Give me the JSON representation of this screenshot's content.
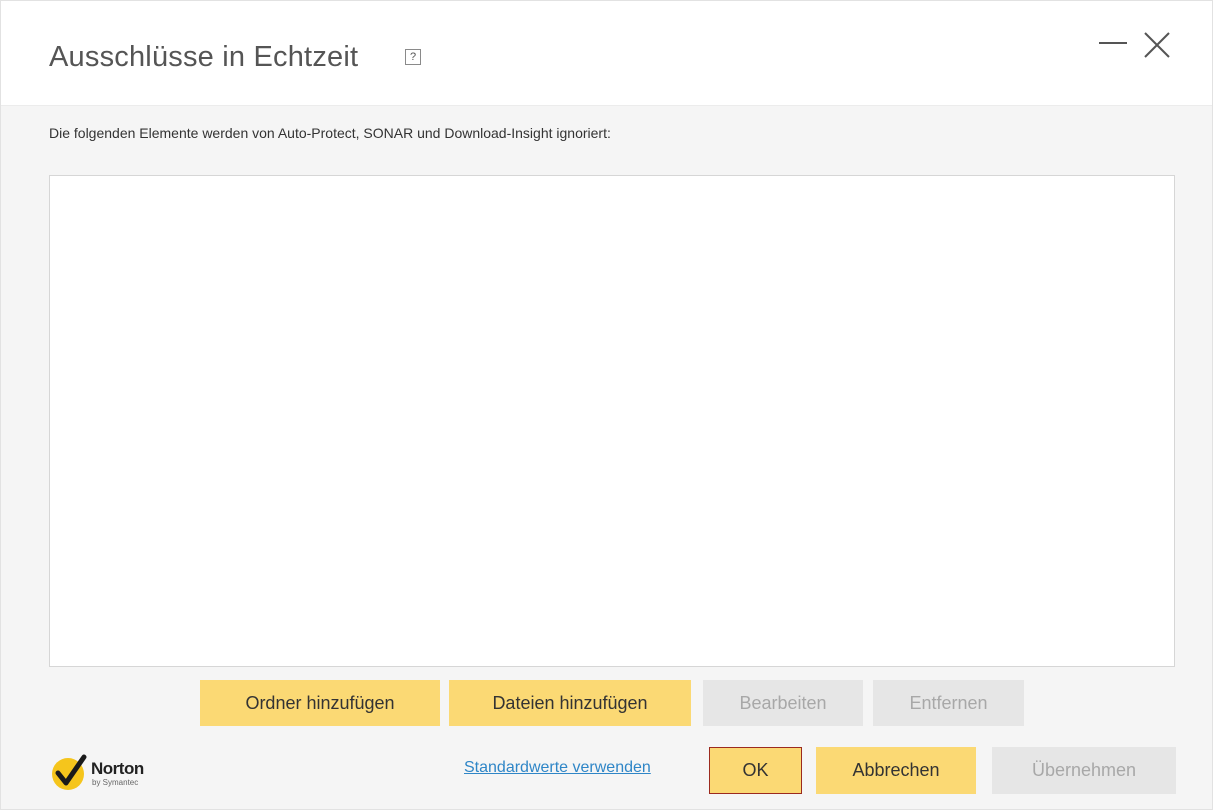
{
  "window": {
    "title": "Ausschlüsse in Echtzeit",
    "help_glyph": "?"
  },
  "main": {
    "description": "Die folgenden Elemente werden von Auto-Protect, SONAR und Download-Insight ignoriert:",
    "exclusions": []
  },
  "actions": {
    "add_folder": "Ordner hinzufügen",
    "add_files": "Dateien hinzufügen",
    "edit": "Bearbeiten",
    "remove": "Entfernen"
  },
  "footer": {
    "logo_name": "Norton",
    "logo_sub": "by Symantec",
    "defaults_link": "Standardwerte verwenden",
    "ok": "OK",
    "cancel": "Abbrechen",
    "apply": "Übernehmen"
  },
  "colors": {
    "accent_yellow": "#fbd974",
    "disabled_gray": "#e6e6e6",
    "link_blue": "#2f86c7",
    "focus_border": "#9b2a1e",
    "norton_yellow": "#f5c51c"
  },
  "icons": {
    "help": "help-icon",
    "minimize": "minimize-icon",
    "close": "close-icon",
    "logo": "norton-checkmark-icon"
  }
}
